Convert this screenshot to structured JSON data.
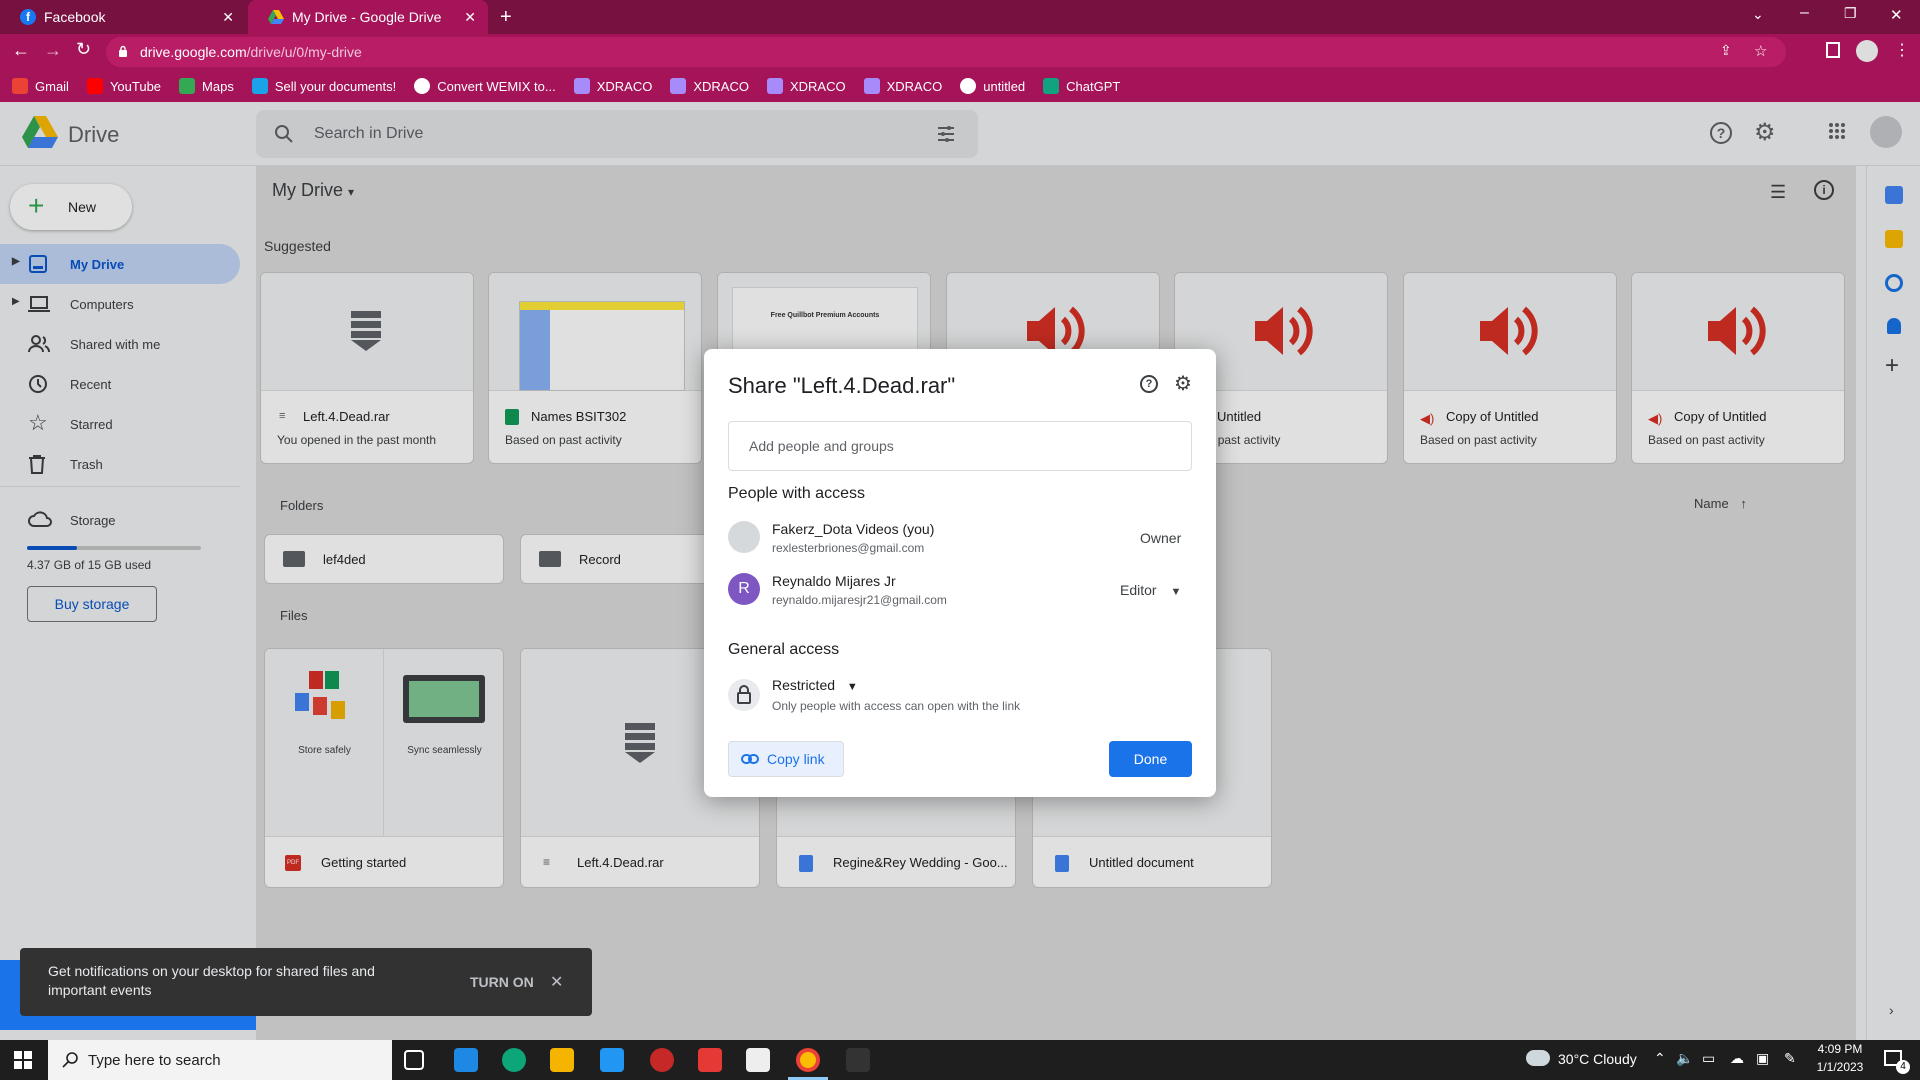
{
  "browser": {
    "tabs": [
      {
        "title": "Facebook",
        "active": false
      },
      {
        "title": "My Drive - Google Drive",
        "active": true
      }
    ],
    "url_host": "drive.google.com",
    "url_path": "/drive/u/0/my-drive",
    "bookmarks": [
      {
        "label": "Gmail",
        "color": "#ea4335"
      },
      {
        "label": "YouTube",
        "color": "#ff0000"
      },
      {
        "label": "Maps",
        "color": "#34a853"
      },
      {
        "label": "Sell your documents!",
        "color": "#1aa3e8"
      },
      {
        "label": "Convert WEMIX to...",
        "color": "#ffffff"
      },
      {
        "label": "XDRACO",
        "color": "#a78bfa"
      },
      {
        "label": "XDRACO",
        "color": "#a78bfa"
      },
      {
        "label": "XDRACO",
        "color": "#a78bfa"
      },
      {
        "label": "XDRACO",
        "color": "#a78bfa"
      },
      {
        "label": "untitled",
        "color": "#ffffff"
      },
      {
        "label": "ChatGPT",
        "color": "#10a37f"
      }
    ]
  },
  "drive": {
    "app_name": "Drive",
    "search_placeholder": "Search in Drive",
    "new_label": "New",
    "location": "My Drive",
    "nav": [
      {
        "label": "My Drive",
        "icon": "my-drive-icon",
        "active": true
      },
      {
        "label": "Computers",
        "icon": "computer-icon"
      },
      {
        "label": "Shared with me",
        "icon": "people-icon"
      },
      {
        "label": "Recent",
        "icon": "clock-icon"
      },
      {
        "label": "Starred",
        "icon": "star-icon"
      },
      {
        "label": "Trash",
        "icon": "trash-icon"
      }
    ],
    "storage_label": "Storage",
    "storage_used": "4.37 GB of 15 GB used",
    "storage_fraction": 0.29,
    "buy_storage": "Buy storage",
    "suggested_heading": "Suggested",
    "suggested": [
      {
        "name": "Left.4.Dead.rar",
        "reason": "You opened in the past month",
        "kind": "archive"
      },
      {
        "name": "Names BSIT302",
        "reason": "Based on past activity",
        "kind": "sheet"
      },
      {
        "name": "",
        "reason": "",
        "kind": "doc",
        "preview_title": "Free Quillbot Premium Accounts"
      },
      {
        "name": "",
        "reason": "",
        "kind": "audio"
      },
      {
        "name": "Untitled",
        "reason": "d on past activity",
        "kind": "audio"
      },
      {
        "name": "Copy of Untitled",
        "reason": "Based on past activity",
        "kind": "audio"
      },
      {
        "name": "Copy of Untitled",
        "reason": "Based on past activity",
        "kind": "audio"
      }
    ],
    "folders_heading": "Folders",
    "sort_label": "Name",
    "folders": [
      {
        "name": "lef4ded"
      },
      {
        "name": "Record"
      }
    ],
    "files_heading": "Files",
    "files": [
      {
        "name": "Getting started",
        "kind": "pdf",
        "caption_left": "Store safely",
        "caption_right": "Sync seamlessly"
      },
      {
        "name": "Left.4.Dead.rar",
        "kind": "archive"
      },
      {
        "name": "Regine&Rey Wedding - Goo...",
        "kind": "doc"
      },
      {
        "name": "Untitled document",
        "kind": "doc"
      }
    ]
  },
  "share_dialog": {
    "title": "Share \"Left.4.Dead.rar\"",
    "add_placeholder": "Add people and groups",
    "people_heading": "People with access",
    "people": [
      {
        "name": "Fakerz_Dota Videos (you)",
        "email": "rexlesterbriones@gmail.com",
        "role": "Owner"
      },
      {
        "name": "Reynaldo Mijares Jr",
        "email": "reynaldo.mijaresjr21@gmail.com",
        "role": "Editor",
        "initial": "R"
      }
    ],
    "general_heading": "General access",
    "access_level": "Restricted",
    "access_desc": "Only people with access can open with the link",
    "copy_link": "Copy link",
    "done": "Done"
  },
  "snackbar": {
    "message": "Get notifications on your desktop for shared files and important events",
    "action": "TURN ON"
  },
  "taskbar": {
    "search_placeholder": "Type here to search",
    "weather": "30°C  Cloudy",
    "time": "4:09 PM",
    "date": "1/1/2023",
    "notifications": "4"
  },
  "colors": {
    "tabbar": "#77113f",
    "toolbar": "#a51458",
    "accent": "#1a73e8",
    "audio_red": "#d93025"
  }
}
